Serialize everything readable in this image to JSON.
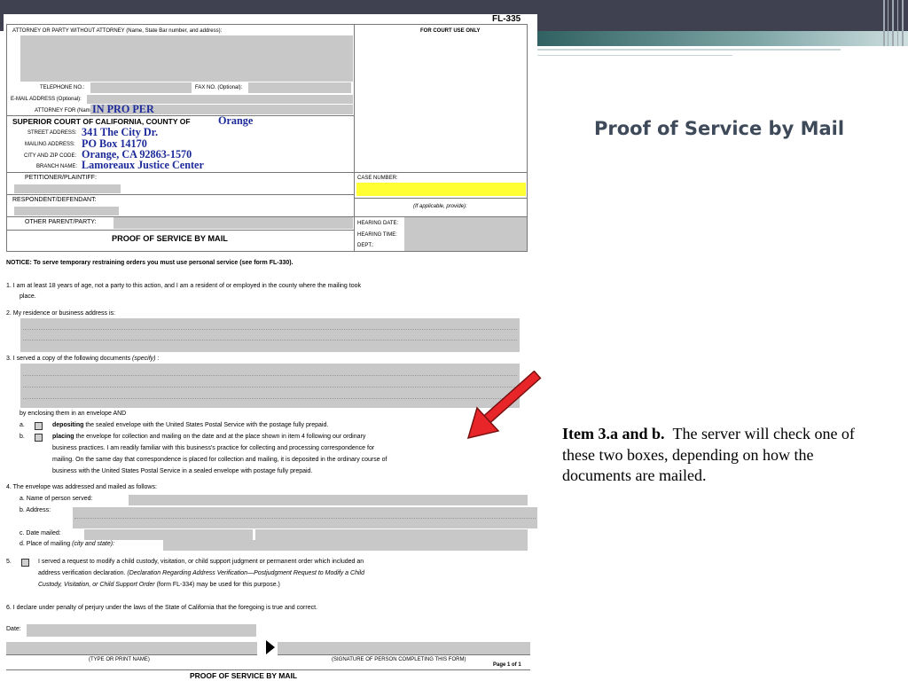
{
  "slide": {
    "title": "Proof of Service by Mail",
    "note_bold": "Item 3.a and b.",
    "note_text": "The server will check one of these two boxes, depending on how the documents are mailed.",
    "arrow_color": "#e8262a"
  },
  "form": {
    "form_number": "FL-335",
    "header": {
      "attorney_party": "ATTORNEY OR PARTY WITHOUT ATTORNEY (Name, State Bar number, and address):",
      "court_use": "FOR COURT USE ONLY",
      "telephone": "TELEPHONE NO.:",
      "fax": "FAX NO. (Optional):",
      "email": "E-MAIL ADDRESS (Optional):",
      "attorney_for": "ATTORNEY FOR (Name):",
      "attorney_for_value": "IN PRO PER",
      "court": "SUPERIOR COURT OF CALIFORNIA, COUNTY OF",
      "county_value": "Orange",
      "street_label": "STREET ADDRESS:",
      "street_value": "341 The City Dr.",
      "mailing_label": "MAILING ADDRESS:",
      "mailing_value": "PO Box 14170",
      "city_label": "CITY AND ZIP CODE:",
      "city_value": "Orange, CA  92863-1570",
      "branch_label": "BRANCH NAME:",
      "branch_value": "Lamoreaux Justice Center",
      "petitioner": "PETITIONER/PLAINTIFF:",
      "respondent": "RESPONDENT/DEFENDANT:",
      "other_parent": "OTHER PARENT/PARTY:",
      "case_number": "CASE NUMBER:",
      "if_applicable": "(If applicable, provide):",
      "hearing_date": "HEARING DATE:",
      "hearing_time": "HEARING TIME:",
      "dept": "DEPT.:",
      "form_title": "PROOF OF SERVICE BY MAIL"
    },
    "notice": "NOTICE: To serve temporary restraining orders you must use personal service (see form FL-330).",
    "item1_a": "1.   I am at least 18 years of age, not a party to this action, and I am a resident of or employed in the county where the mailing took",
    "item1_b": "place.",
    "item2": "2.   My residence or business address is:",
    "item3": "3.   I served a copy of the following documents",
    "item3_specify": "(specify) :",
    "enclosing": "by enclosing them in an envelope AND",
    "item3a_letter": "a.",
    "item3a_bold": "depositing",
    "item3a_text": "the sealed envelope with the United States Postal Service with the postage fully prepaid.",
    "item3b_letter": "b.",
    "item3b_bold": "placing",
    "item3b_text": "the envelope for collection and mailing on the date and at the place shown in item 4 following our ordinary",
    "item3b_l2": "business practices. I am readily familiar with this business's practice for collecting and processing correspondence for",
    "item3b_l3": "mailing. On the same day that correspondence is placed for collection and mailing, it is deposited in the ordinary course of",
    "item3b_l4": "business with the United States Postal Service in a sealed envelope with postage fully prepaid.",
    "item4": "4.   The envelope was addressed and mailed as follows:",
    "item4a": "a.   Name of person served:",
    "item4b": "b.   Address:",
    "item4c": "c.   Date mailed:",
    "item4d": "d.   Place of mailing",
    "item4d_italic": "(city and state):",
    "item5_num": "5.",
    "item5_l1": "I served a request to modify a child custody, visitation, or child support judgment or permanent order which included an",
    "item5_l2a": "address verification declaration.",
    "item5_l2b": "(Declaration Regarding Address Verification—Postjudgment Request to Modify a Child",
    "item5_l3a": "Custody, Visitation, or Child Support Order",
    "item5_l3b": "(form FL-334) may be used for this purpose.)",
    "item6": "6.   I declare under penalty of perjury under the laws of the State of California that the foregoing is true and correct.",
    "date": "Date:",
    "type_name": "(TYPE OR PRINT NAME)",
    "signature": "(SIGNATURE OF PERSON COMPLETING THIS FORM)",
    "page": "Page 1 of 1",
    "footer_title": "PROOF OF SERVICE BY MAIL"
  }
}
